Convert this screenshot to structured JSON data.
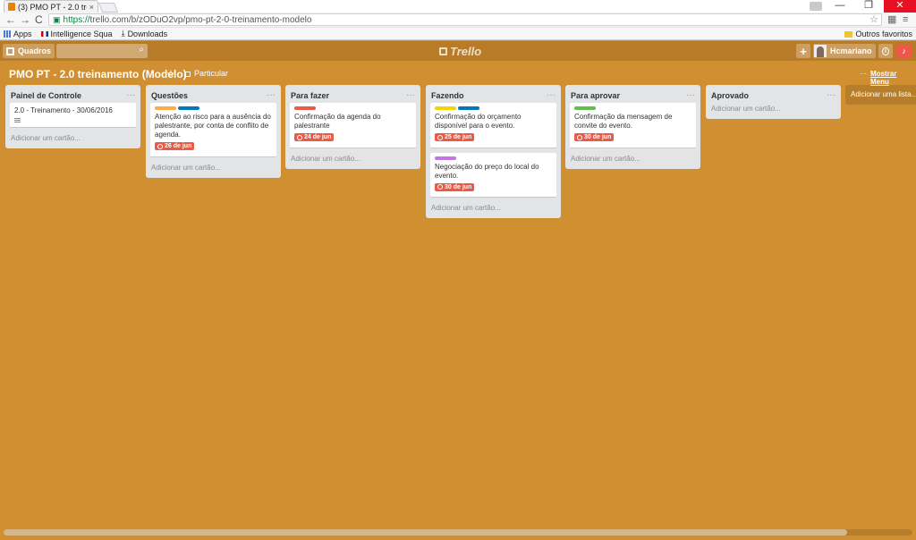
{
  "browser": {
    "tab_title": "(3) PMO PT - 2.0 trei",
    "tab_close": "×",
    "url_https": "https://",
    "url_rest": "trello.com/b/zODuO2vp/pmo-pt-2-0-treinamento-modelo",
    "nav_back": "←",
    "nav_forward": "→",
    "nav_reload": "C",
    "win_min": "—",
    "win_restore": "❐",
    "win_close": "✕",
    "star": "☆",
    "menu": "≡",
    "bookmarks": [
      {
        "label": "Apps"
      },
      {
        "label": "Intelligence Squa"
      },
      {
        "label": "Downloads"
      }
    ],
    "other_bookmarks": "Outros favoritos"
  },
  "header": {
    "boards_label": "Quadros",
    "logo": "Trello",
    "plus": "+",
    "username": "Hcmariano",
    "info": "i",
    "bell": "♪"
  },
  "board": {
    "title": "PMO PT - 2.0 treinamento (Modelo)",
    "star": "☆",
    "visibility": "Particular",
    "show_menu_dots": "···",
    "show_menu": "Mostrar Menu",
    "add_list": "Adicionar uma lista..."
  },
  "lists": [
    {
      "title": "Painel de Controle",
      "menu": "···",
      "cards": [
        {
          "text": "2.0 - Treinamento - 30/06/2016"
        }
      ],
      "add_card": "Adicionar um cartão..."
    },
    {
      "title": "Questões",
      "menu": "···",
      "cards": [
        {
          "text": "Atenção ao risco para a ausência do palestrante, por conta de conflito de agenda.",
          "due": "26 de jun"
        }
      ],
      "add_card": "Adicionar um cartão..."
    },
    {
      "title": "Para fazer",
      "menu": "···",
      "cards": [
        {
          "text": "Confirmação da agenda do palestrante",
          "due": "24 de jun"
        }
      ],
      "add_card": "Adicionar um cartão..."
    },
    {
      "title": "Fazendo",
      "menu": "···",
      "cards": [
        {
          "text": "Confirmação do orçamento disponível para o evento.",
          "due": "25 de jun"
        },
        {
          "text": "Negociação do preço do local do evento.",
          "due": "30 de jun"
        }
      ],
      "add_card": "Adicionar um cartão..."
    },
    {
      "title": "Para aprovar",
      "menu": "···",
      "cards": [
        {
          "text": "Confirmação da mensagem de convite do evento.",
          "due": "30 de jun"
        }
      ],
      "add_card": "Adicionar um cartão..."
    },
    {
      "title": "Aprovado",
      "menu": "···",
      "add_card": "Adicionar um cartão..."
    }
  ],
  "colors": {
    "board_bg": "#d08f31",
    "header_bg": "#b87b27",
    "label_orange": "#ffab4a",
    "label_blue": "#0079bf",
    "label_red": "#eb5a46",
    "label_yellow": "#f2d600",
    "label_purple": "#c377e0",
    "label_green": "#61bd4f",
    "due_badge": "#eb5a46"
  }
}
